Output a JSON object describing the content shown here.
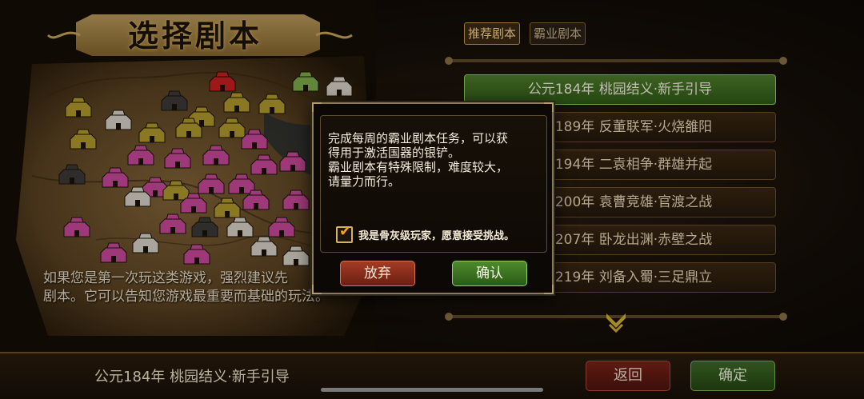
{
  "page": {
    "title": "选择剧本",
    "tip_line1": "如果您是第一次玩这类游戏，强烈建议先",
    "tip_line2": "剧本。它可以告知您游戏最重要而基础的玩法。"
  },
  "tabs": [
    {
      "label": "推荐剧本",
      "active": true
    },
    {
      "label": "霸业剧本",
      "active": false
    }
  ],
  "scenarios": [
    {
      "label": "公元184年 桃园结义·新手引导",
      "selected": true
    },
    {
      "label": "公元189年 反董联军·火烧雒阳",
      "selected": false
    },
    {
      "label": "公元194年 二袁相争·群雄并起",
      "selected": false
    },
    {
      "label": "公元200年 袁曹竞雄·官渡之战",
      "selected": false
    },
    {
      "label": "公元207年 卧龙出渊·赤壁之战",
      "selected": false
    },
    {
      "label": "公元219年 刘备入蜀·三足鼎立",
      "selected": false
    }
  ],
  "bottom": {
    "current_scenario": "公元184年 桃园结义·新手引导",
    "back_label": "返回",
    "confirm_label": "确定"
  },
  "modal": {
    "message_line1": "完成每周的霸业剧本任务，可以获",
    "message_line2": "得用于激活国器的银铲。",
    "message_line3": "霸业剧本有特殊限制，难度较大，",
    "message_line4": "请量力而行。",
    "checkbox_label": "我是骨灰级玩家，愿意接受挑战。",
    "checkbox_checked": true,
    "cancel_label": "放弃",
    "confirm_label": "确认"
  },
  "colors": {
    "selected_row": "#4f7d2b",
    "cancel_red": "#a33b24",
    "confirm_green": "#4d8a2c",
    "gold_border": "#c79a43"
  },
  "map_cities": [
    {
      "faction": "red"
    },
    {
      "faction": "green"
    },
    {
      "faction": "white"
    },
    {
      "faction": "yellow"
    },
    {
      "faction": "gray"
    },
    {
      "faction": "yellow"
    },
    {
      "faction": "yellow"
    },
    {
      "faction": "yellow"
    },
    {
      "faction": "white"
    },
    {
      "faction": "yellow"
    },
    {
      "faction": "yellow"
    },
    {
      "faction": "yellow"
    },
    {
      "faction": "pink"
    },
    {
      "faction": "yellow"
    },
    {
      "faction": "pink"
    },
    {
      "faction": "pink"
    },
    {
      "faction": "pink"
    },
    {
      "faction": "pink"
    },
    {
      "faction": "pink"
    },
    {
      "faction": "gray"
    },
    {
      "faction": "pink"
    },
    {
      "faction": "pink"
    },
    {
      "faction": "yellow"
    },
    {
      "faction": "pink"
    },
    {
      "faction": "pink"
    },
    {
      "faction": "white"
    },
    {
      "faction": "pink"
    },
    {
      "faction": "yellow"
    },
    {
      "faction": "pink"
    },
    {
      "faction": "pink"
    },
    {
      "faction": "pink"
    },
    {
      "faction": "pink"
    },
    {
      "faction": "gray"
    },
    {
      "faction": "white"
    },
    {
      "faction": "pink"
    },
    {
      "faction": "pink"
    },
    {
      "faction": "white"
    },
    {
      "faction": "pink"
    },
    {
      "faction": "white"
    },
    {
      "faction": "white"
    }
  ]
}
